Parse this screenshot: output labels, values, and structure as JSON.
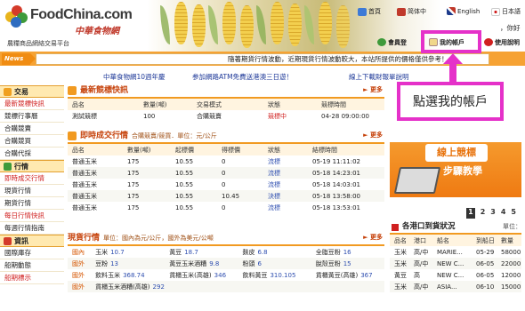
{
  "header": {
    "brand": "FoodChina.com",
    "brand_cn": "中華食物網",
    "tagline": "農糧商品網絡交易平台",
    "links": [
      {
        "label": "首頁",
        "icon": "home-icon"
      },
      {
        "label": "简体中",
        "icon": "simplified-chinese-icon"
      },
      {
        "label": "English",
        "icon": "uk-flag-icon"
      },
      {
        "label": "日本語",
        "icon": "japan-flag-icon"
      }
    ],
    "account_links": [
      {
        "label": "會員登",
        "icon": "member-login-icon"
      },
      {
        "label": "我的帳戶",
        "icon": "my-account-icon"
      },
      {
        "label": "使用說明",
        "icon": "help-icon"
      }
    ],
    "greeting": "，你好"
  },
  "news": {
    "tag": "News",
    "ticker": "隨著期貨行情波動，近期現貨行情波動較大，本站所提供的價格僅供參考！"
  },
  "promo_links": [
    "中華食物網10週年慶",
    "参加網路ATM免費送港澳三日遊！",
    "線上下載財報單說明"
  ],
  "sidebar": [
    {
      "heading": "交易",
      "icon": "trade-icon",
      "items": [
        {
          "label": "最新競標快訊",
          "red": true
        },
        {
          "label": "競標行事曆",
          "red": false
        },
        {
          "label": "合購競賣",
          "red": false
        },
        {
          "label": "合購競買",
          "red": false
        },
        {
          "label": "合購代採",
          "red": false
        }
      ]
    },
    {
      "heading": "行情",
      "icon": "quotes-icon",
      "items": [
        {
          "label": "即時成交行情",
          "red": true
        },
        {
          "label": "現貨行情",
          "red": false
        },
        {
          "label": "期貨行情",
          "red": false
        },
        {
          "label": "每日行情快訊",
          "red": true
        },
        {
          "label": "每週行情指南",
          "red": false
        }
      ]
    },
    {
      "heading": "資訊",
      "icon": "info-icon",
      "items": [
        {
          "label": "國際庫存",
          "red": false
        },
        {
          "label": "船期動態",
          "red": false
        },
        {
          "label": "船期標示",
          "red": true
        }
      ]
    }
  ],
  "bidding": {
    "title": "最新競標快訊",
    "more": "更多",
    "headers": [
      "品名",
      "數量(噸)",
      "交易模式",
      "狀態",
      "競標時間"
    ],
    "rows": [
      [
        "測試競標",
        "100",
        "合購競賣",
        "競標中",
        "04-28 09:00:00"
      ]
    ]
  },
  "trades": {
    "title": "即時成交行情",
    "subtitle": "合購競賣/競買．單位：元/公斤",
    "more": "更多",
    "headers": [
      "品名",
      "數量(噸)",
      "起標價",
      "得標價",
      "狀態",
      "結標時間"
    ],
    "rows": [
      [
        "普通玉米",
        "175",
        "10.55",
        "0",
        "流標",
        "05-19 11:11:02"
      ],
      [
        "普通玉米",
        "175",
        "10.55",
        "0",
        "流標",
        "05-18 14:23:01"
      ],
      [
        "普通玉米",
        "175",
        "10.55",
        "0",
        "流標",
        "05-18 14:03:01"
      ],
      [
        "普通玉米",
        "175",
        "10.55",
        "10.45",
        "決標",
        "05-18 13:58:00"
      ],
      [
        "普通玉米",
        "175",
        "10.55",
        "0",
        "流標",
        "05-18 13:53:01"
      ]
    ]
  },
  "spot": {
    "title": "現貨行情",
    "subtitle": "單位：國內為元/公斤，國外為美元/公噸",
    "more": "更多",
    "rows": [
      {
        "region": "國內",
        "items": [
          [
            "玉米",
            "10.7"
          ],
          [
            "黃豆",
            "18.7"
          ],
          [
            "麩皮",
            "6.8"
          ],
          [
            "全脂豆粉",
            "16"
          ]
        ]
      },
      {
        "region": "國外",
        "items": [
          [
            "豆粉",
            "13"
          ],
          [
            "黃豆玉米酒糟",
            "9.8"
          ],
          [
            "粉頭",
            "6"
          ],
          [
            "脫殼豆粉",
            "15"
          ]
        ]
      },
      {
        "region": "國外",
        "items": [
          [
            "飲料玉米",
            "368.74"
          ],
          [
            "貨櫃玉米(高雄)",
            "346"
          ],
          [
            "飲料黃豆",
            "310.105"
          ],
          [
            "貨櫃黃豆(高雄)",
            "367"
          ]
        ]
      },
      {
        "region": "國外",
        "items": [
          [
            "貨櫃玉米酒糟(高雄)",
            "292"
          ]
        ]
      }
    ]
  },
  "banner": {
    "title": "線上競標",
    "subtitle": "步驟教學",
    "pages": [
      "1",
      "2",
      "3",
      "4",
      "5"
    ]
  },
  "port": {
    "title": "各港口到貨狀況",
    "unit": "單位：",
    "headers": [
      "品名",
      "港口",
      "船名",
      "到船日",
      "數量"
    ],
    "rows": [
      [
        "玉米",
        "高/中",
        "MARIE...",
        "05-29",
        "58000"
      ],
      [
        "玉米",
        "高/中",
        "NEW C...",
        "06-05",
        "22000"
      ],
      [
        "黃豆",
        "高",
        "NEW C...",
        "06-05",
        "12000"
      ],
      [
        "玉米",
        "高/中",
        "ASIA...",
        "06-10",
        "15000"
      ]
    ]
  },
  "annotation": {
    "label": "點選我的帳戶"
  },
  "colors": {
    "accent": "#f19a21",
    "highlight": "#e531c9",
    "link": "#1f3a99"
  }
}
